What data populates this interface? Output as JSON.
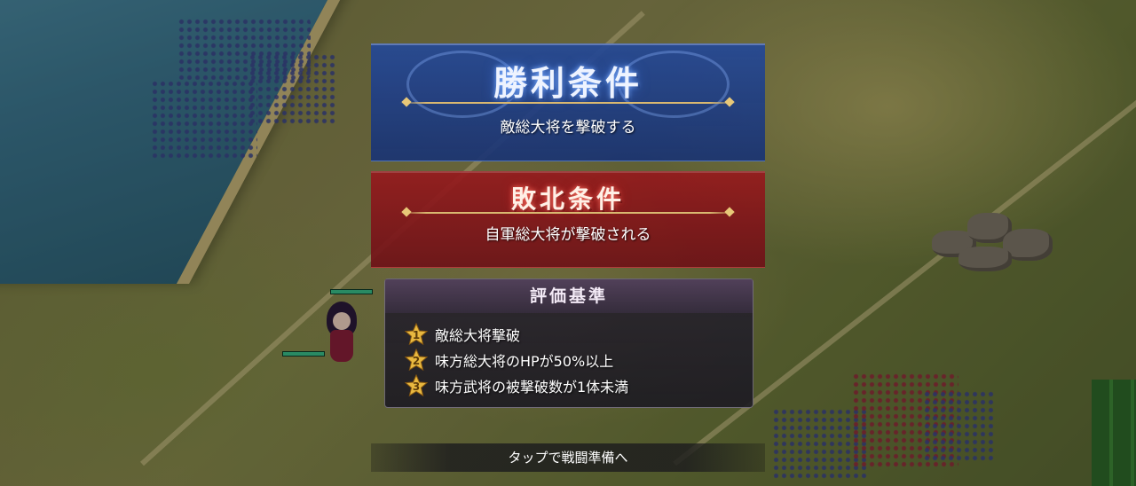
{
  "victory": {
    "title": "勝利条件",
    "condition": "敵総大将を撃破する"
  },
  "defeat": {
    "title": "敗北条件",
    "condition": "自軍総大将が撃破される"
  },
  "evaluation": {
    "title": "評価基準",
    "criteria": [
      {
        "rank": "1",
        "text": "敵総大将撃破"
      },
      {
        "rank": "2",
        "text": "味方総大将のHPが50%以上"
      },
      {
        "rank": "3",
        "text": "味方武将の被撃破数が1体未満"
      }
    ]
  },
  "prompt": "タップで戦闘準備へ",
  "colors": {
    "victory": "#24489a",
    "defeat": "#961c1c",
    "star": "#e8b840"
  }
}
